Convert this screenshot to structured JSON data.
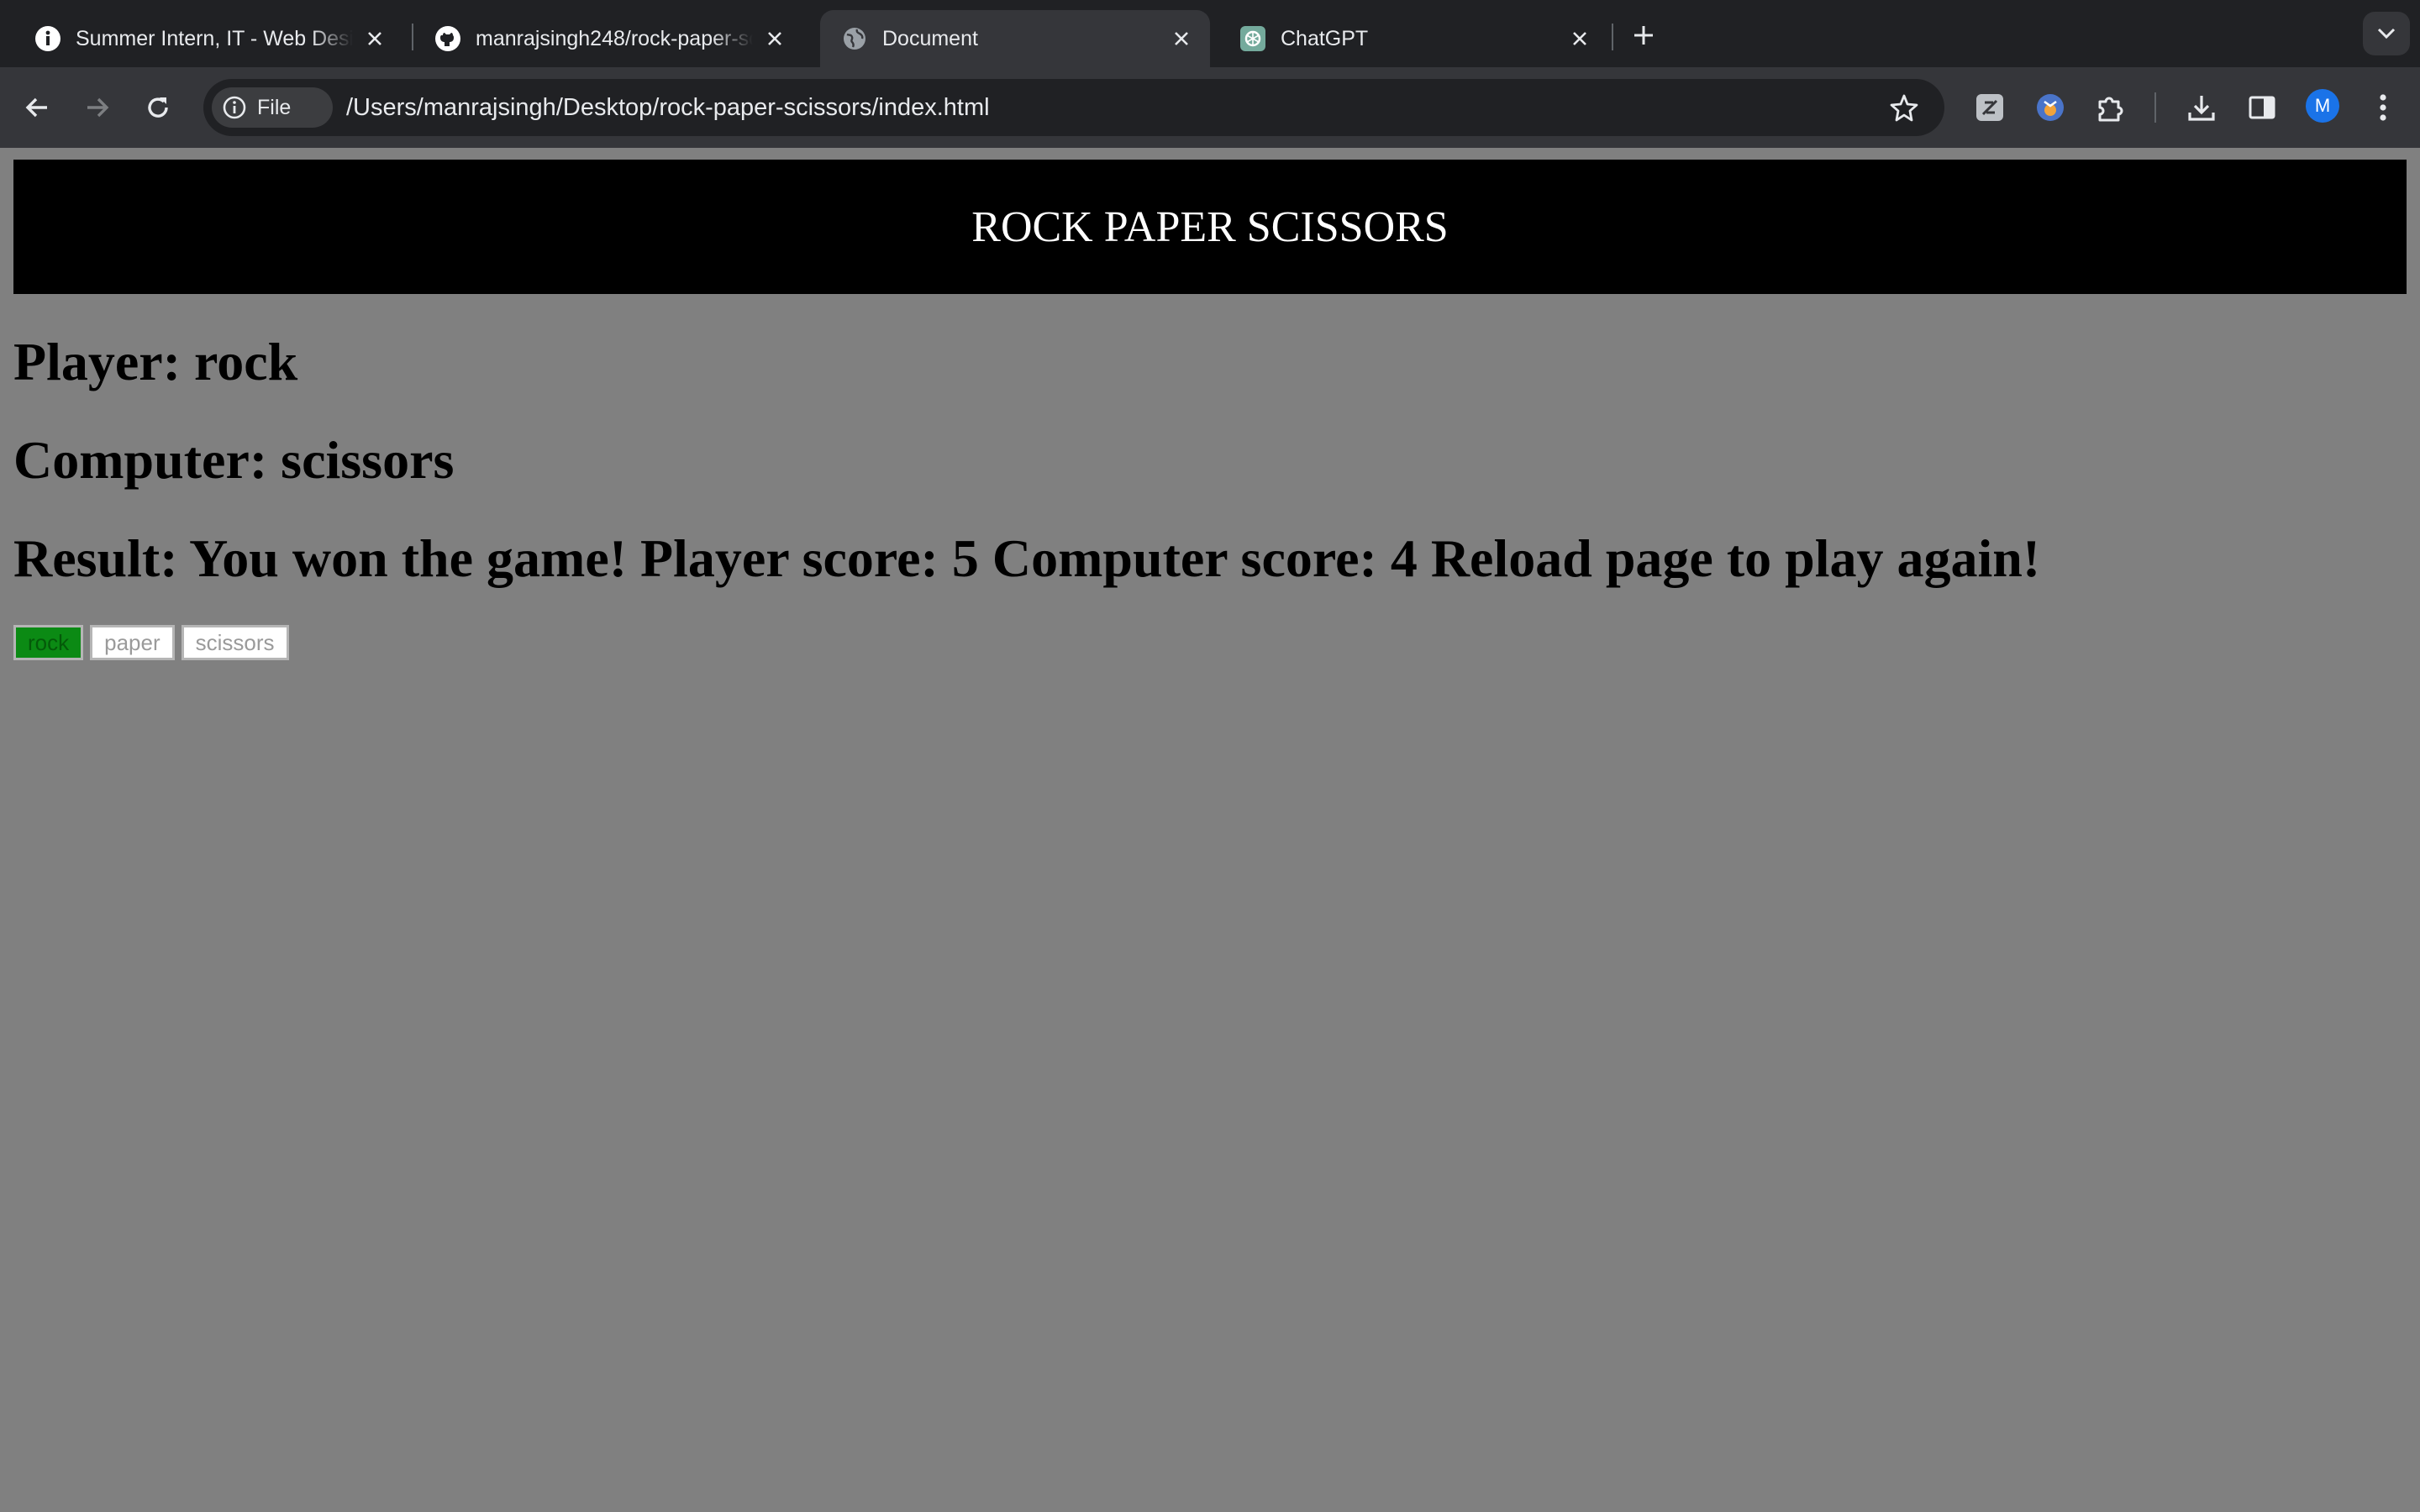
{
  "browser": {
    "tabs": [
      {
        "title": "Summer Intern, IT - Web Design",
        "icon": "info-icon",
        "active": false
      },
      {
        "title": "manrajsingh248/rock-paper-scissors",
        "icon": "github-icon",
        "active": false
      },
      {
        "title": "Document",
        "icon": "globe-icon",
        "active": true
      },
      {
        "title": "ChatGPT",
        "icon": "chatgpt-icon",
        "active": false
      }
    ],
    "site_chip": "File",
    "url": "/Users/manrajsingh/Desktop/rock-paper-scissors/index.html",
    "profile_initial": "M"
  },
  "page": {
    "header": "ROCK PAPER SCISSORS",
    "player_line": "Player: rock",
    "computer_line": "Computer: scissors",
    "result_line": "Result: You won the game! Player score: 5 Computer score: 4 Reload page to play again!",
    "choices": [
      {
        "label": "rock",
        "selected": true
      },
      {
        "label": "paper",
        "selected": false
      },
      {
        "label": "scissors",
        "selected": false
      }
    ]
  },
  "colors": {
    "page_background": "#808080",
    "header_background": "#000000",
    "selected_choice": "#0b8a14"
  }
}
